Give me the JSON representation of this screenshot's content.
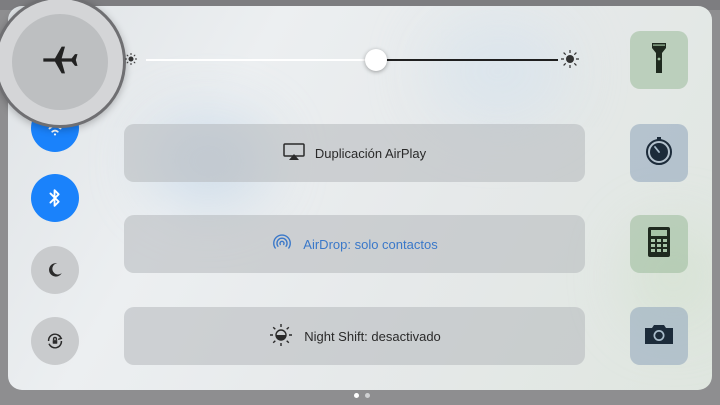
{
  "control_center": {
    "toggles": [
      {
        "id": "airplane",
        "icon": "airplane-icon",
        "state": "off"
      },
      {
        "id": "wifi",
        "icon": "wifi-icon",
        "state": "on"
      },
      {
        "id": "bluetooth",
        "icon": "bluetooth-icon",
        "state": "on"
      },
      {
        "id": "do-not-disturb",
        "icon": "moon-icon",
        "state": "off"
      },
      {
        "id": "rotation-lock",
        "icon": "rotation-lock-icon",
        "state": "off"
      }
    ],
    "brightness": {
      "level": 0.5
    },
    "airplay": {
      "label": "Duplicación AirPlay",
      "icon": "airplay-icon"
    },
    "airdrop": {
      "label": "AirDrop: solo contactos",
      "icon": "airdrop-icon"
    },
    "night_shift": {
      "label": "Night Shift: desactivado",
      "icon": "night-shift-icon"
    },
    "tiles": [
      {
        "id": "flashlight",
        "icon": "flashlight-icon"
      },
      {
        "id": "timer",
        "icon": "timer-icon"
      },
      {
        "id": "calculator",
        "icon": "calculator-icon"
      },
      {
        "id": "camera",
        "icon": "camera-icon"
      }
    ],
    "page_indicator": {
      "pages": 2,
      "current": 1
    },
    "colors": {
      "accent_blue": "#1a82fb",
      "airdrop_blue": "#3a78c9"
    }
  }
}
